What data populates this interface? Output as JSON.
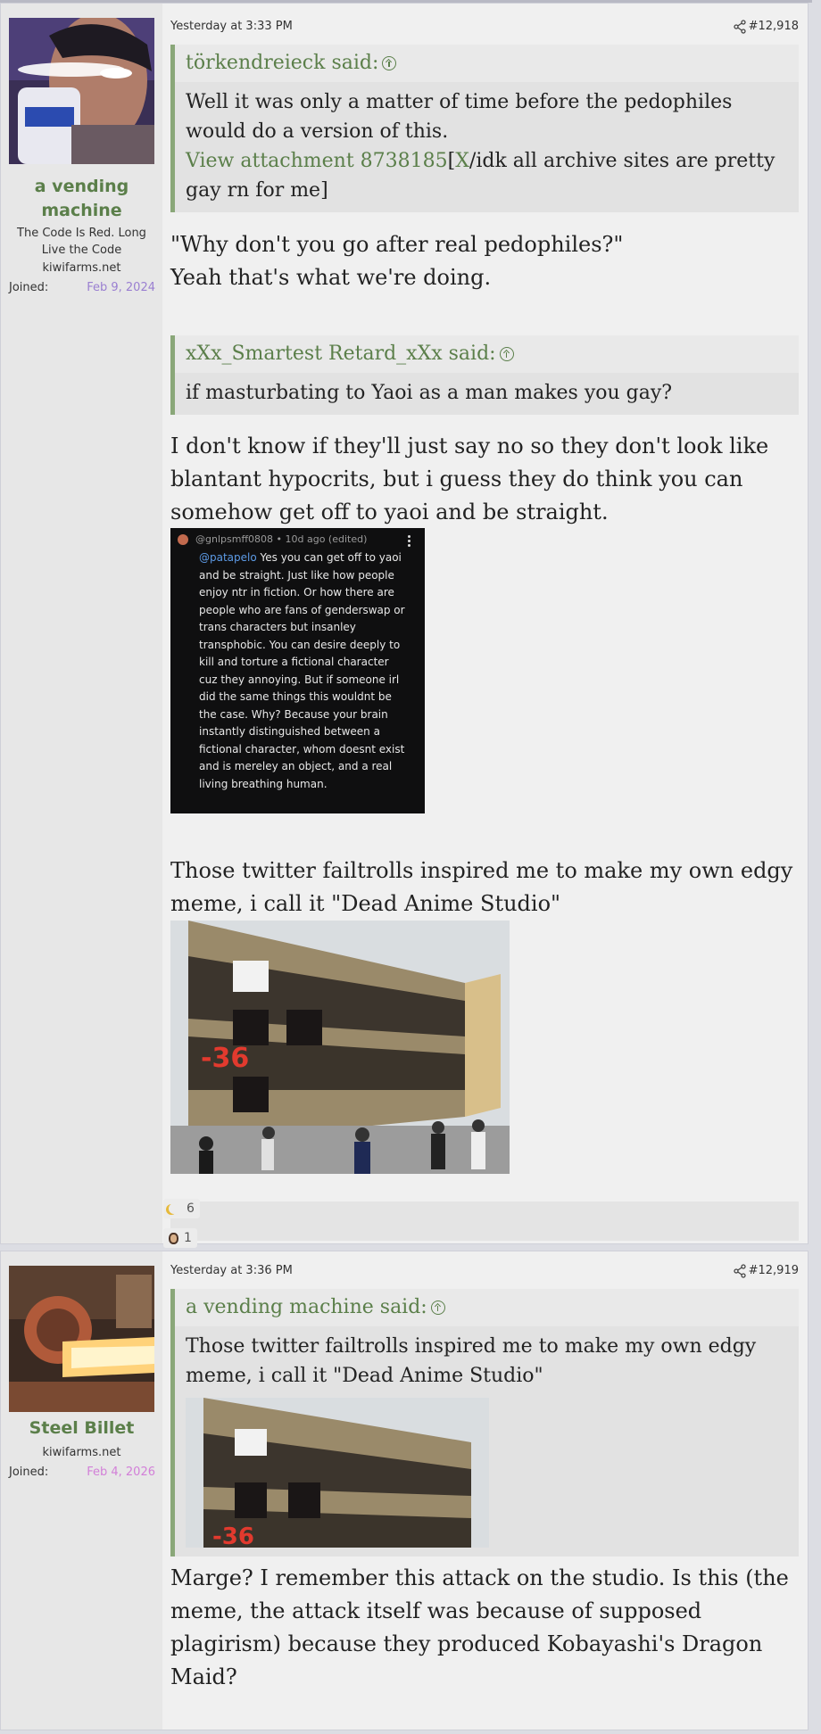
{
  "posts": [
    {
      "user": {
        "name": "a vending machine",
        "title": "The Code Is Red. Long Live the Code",
        "site": "kiwifarms.net",
        "joined_label": "Joined:",
        "joined_date": "Feb 9, 2024",
        "joined_color": "#9a7fd1"
      },
      "time": "Yesterday at 3:33 PM",
      "post_number": "#12,918",
      "quotes": [
        {
          "author": "törkendreieck said:",
          "text_before": "Well it was only a matter of time before the pedophiles would do a version of this.",
          "attachment_link": "View attachment 8738185",
          "bracket_open": "[",
          "x_link": "X",
          "text_after": "/idk all archive sites are pretty gay rn for me]"
        },
        {
          "author": "xXx_Smartest Retard_xXx said:",
          "text": "if masturbating to Yaoi as a man makes you gay?"
        }
      ],
      "body_1_line1": "\"Why don't you go after real pedophiles?\"",
      "body_1_line2": "Yeah that's what we're doing.",
      "body_2": "I don't know if they'll just say no so they don't look like blantant hypocrits, but i guess they do think you can somehow get off to yaoi and be straight.",
      "screenshot": {
        "header": "@gnlpsmff0808 • 10d ago (edited)",
        "mention": "@patapelo",
        "text": " Yes you can get off to yaoi and be straight. Just like how people enjoy ntr in fiction. Or how there are people who are fans of genderswap or trans characters but insanley transphobic. You can desire deeply to kill and torture a fictional character cuz they annoying. But if someone irl did the same things this wouldnt be the case. Why? Because your brain instantly distinguished between a fictional character, whom doesnt exist and is mereley an object, and a real living breathing human."
      },
      "body_3": "Those twitter failtrolls inspired me to make my own edgy meme, i call it \"Dead Anime Studio\"",
      "image_text": "-36",
      "reactions": [
        {
          "icon": "moon-icon",
          "count": "6"
        },
        {
          "icon": "face-icon",
          "count": "1"
        }
      ]
    },
    {
      "user": {
        "name": "Steel Billet",
        "site": "kiwifarms.net",
        "joined_label": "Joined:",
        "joined_date": "Feb 4, 2026",
        "joined_color": "#d27fd8"
      },
      "time": "Yesterday at 3:36 PM",
      "post_number": "#12,919",
      "quote": {
        "author": "a vending machine said:",
        "text": "Those twitter failtrolls inspired me to make my own edgy meme, i call it \"Dead Anime Studio\"",
        "image_text": "-36"
      },
      "body": "Marge? I remember this attack on the studio. Is this (the meme, the attack itself was because of supposed plagirism) because they produced Kobayashi's Dragon Maid?"
    }
  ]
}
